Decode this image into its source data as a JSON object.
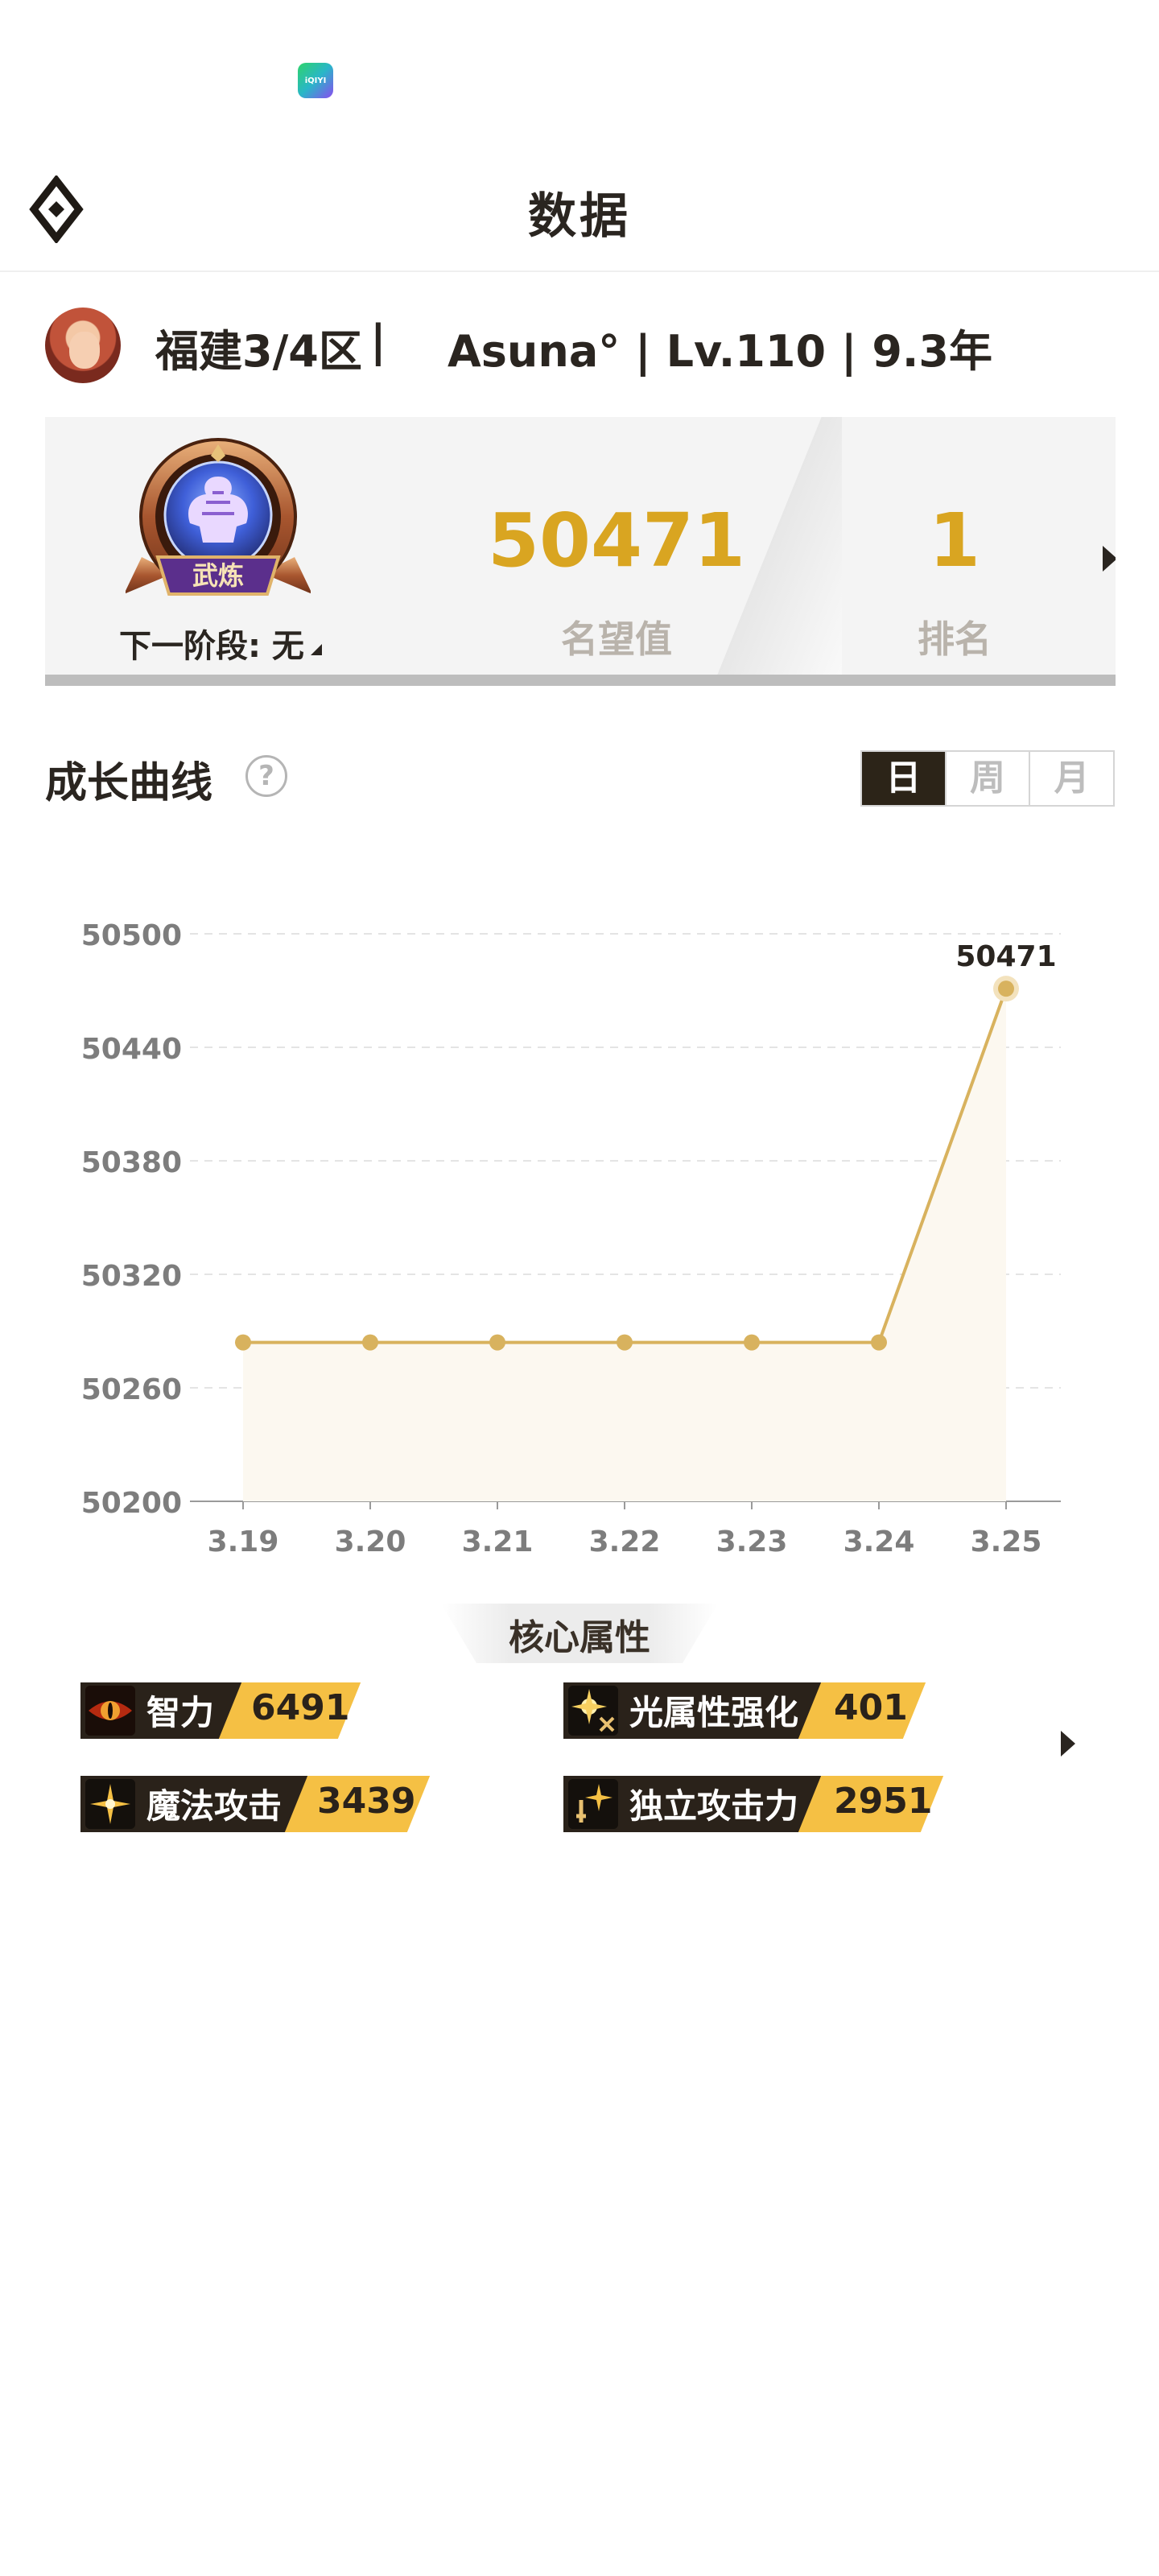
{
  "status_bar": {
    "app_icon_text": "iQIYI"
  },
  "header": {
    "title": "数据"
  },
  "profile": {
    "server": "福建3/4区",
    "separator": "|",
    "name_line": "Asuna° | Lv.110 | 9.3年"
  },
  "stats": {
    "badge_text": "武炼",
    "next_stage": "下一阶段: 无",
    "fame_value": "50471",
    "fame_label": "名望值",
    "rank_value": "1",
    "rank_label": "排名"
  },
  "growth": {
    "title": "成长曲线",
    "help": "?",
    "tabs": [
      {
        "label": "日",
        "active": true
      },
      {
        "label": "周",
        "active": false
      },
      {
        "label": "月",
        "active": false
      }
    ]
  },
  "chart_data": {
    "type": "line",
    "x": [
      "3.19",
      "3.20",
      "3.21",
      "3.22",
      "3.23",
      "3.24",
      "3.25"
    ],
    "values": [
      50284,
      50284,
      50284,
      50284,
      50284,
      50284,
      50471
    ],
    "ylim": [
      50200,
      50500
    ],
    "yticks": [
      50500,
      50440,
      50380,
      50320,
      50260,
      50200
    ],
    "data_labels": [
      {
        "index": 6,
        "text": "50471"
      }
    ],
    "grid": true,
    "colors": {
      "line": "#d8b25e",
      "point": "#d8b25e",
      "area": "#fcf8f0",
      "grid": "#e4e4e4"
    }
  },
  "core": {
    "title": "核心属性",
    "attributes": [
      {
        "label": "智力",
        "value": "6491",
        "icon": "eye-icon"
      },
      {
        "label": "光属性强化",
        "value": "401",
        "icon": "light-burst-icon"
      },
      {
        "label": "魔法攻击",
        "value": "3439",
        "icon": "sparkle-icon"
      },
      {
        "label": "独立攻击力",
        "value": "2951",
        "icon": "star-sword-icon"
      }
    ]
  },
  "colors": {
    "accent": "#d9a521",
    "dark": "#2c2418",
    "gold_tag": "#f5c044"
  }
}
